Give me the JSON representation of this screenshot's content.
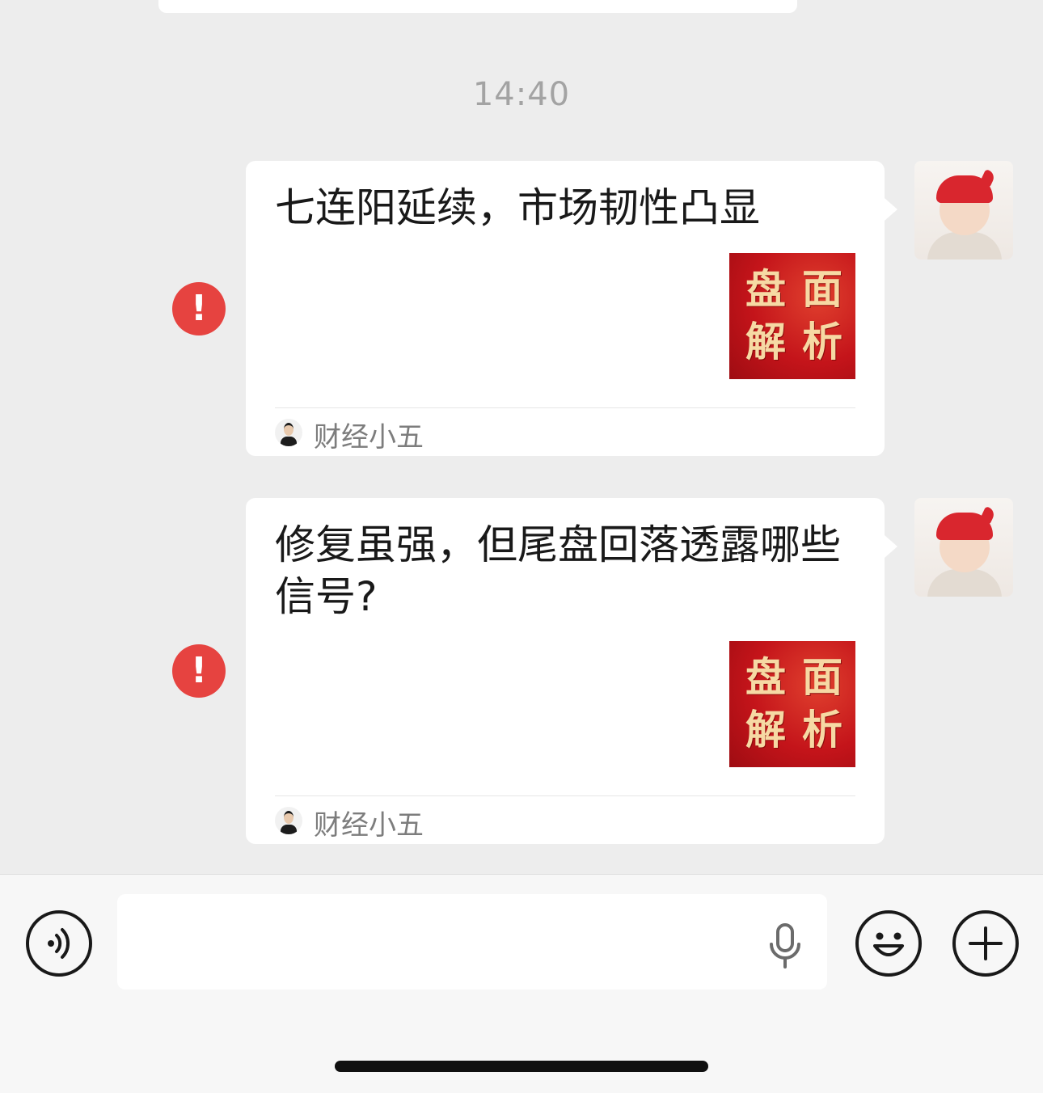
{
  "chat": {
    "timestamp": "14:40",
    "messages": [
      {
        "title": "七连阳延续，市场韧性凸显",
        "thumbnail_lines": [
          "盘",
          "面",
          "解",
          "析"
        ],
        "source": "财经小五",
        "status": "failed"
      },
      {
        "title": "修复虽强，但尾盘回落透露哪些信号?",
        "thumbnail_lines": [
          "盘",
          "面",
          "解",
          "析"
        ],
        "source": "财经小五",
        "status": "failed"
      }
    ]
  },
  "icons": {
    "error": "!",
    "voice": "voice-icon",
    "mic": "microphone-icon",
    "emoji": "emoji-icon",
    "plus": "plus-icon"
  },
  "colors": {
    "background": "#ededed",
    "error_red": "#e64340",
    "thumbnail_red": "#c4141a",
    "thumbnail_text": "#f6d9a4"
  },
  "input": {
    "value": "",
    "placeholder": ""
  }
}
